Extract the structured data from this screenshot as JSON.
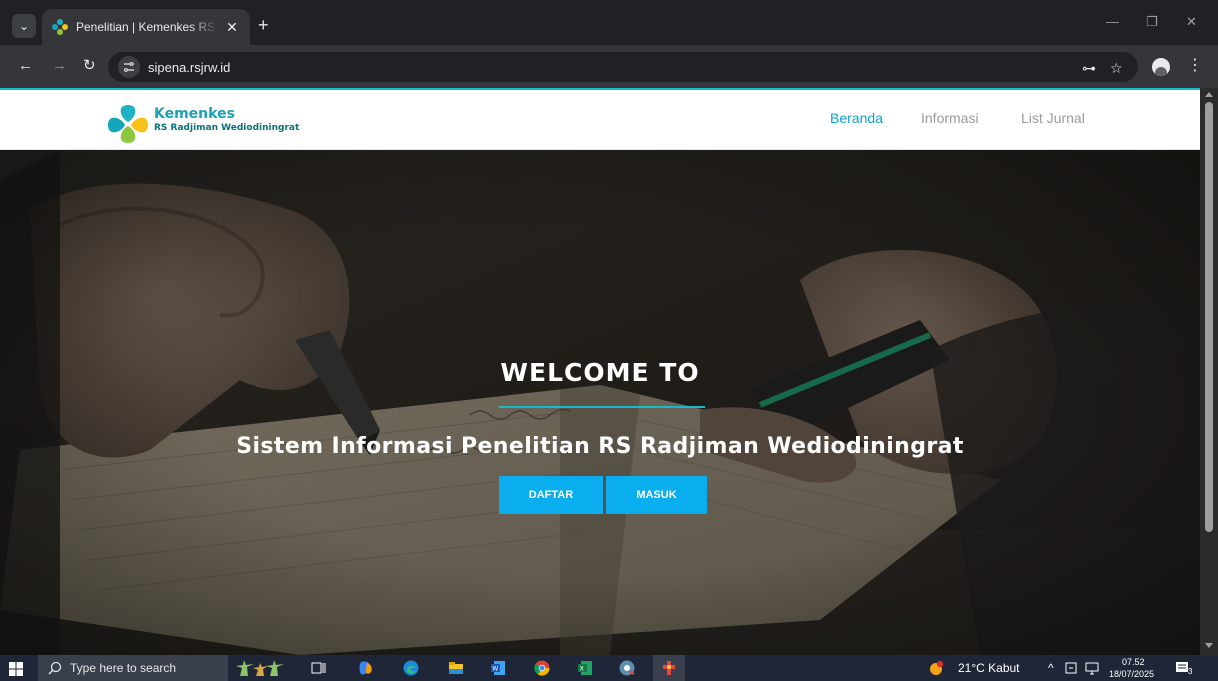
{
  "browser": {
    "tab_title": "Penelitian | Kemenkes RS Radjiman Wediodiningrat",
    "tab_close": "✕",
    "new_tab": "+",
    "tab_search_icon": "⌄",
    "window_controls": {
      "minimize": "—",
      "restore": "❐",
      "close": "✕"
    },
    "back_icon": "←",
    "forward_icon": "→",
    "reload_icon": "↻",
    "url": "sipena.rsjrw.id",
    "password_key_icon": "⊶",
    "bookmark_icon": "☆",
    "menu_icon": "⋮"
  },
  "site": {
    "brand_name": "Kemenkes",
    "brand_subtitle": "RS Radjiman Wediodiningrat",
    "nav": [
      {
        "label": "Beranda",
        "active": true
      },
      {
        "label": "Informasi",
        "active": false
      },
      {
        "label": "List Jurnal",
        "active": false
      }
    ],
    "hero": {
      "heading": "WELCOME TO",
      "subtitle": "Sistem Informasi Penelitian RS Radjiman Wediodiningrat",
      "buttons": [
        {
          "label": "DAFTAR"
        },
        {
          "label": "MASUK"
        }
      ]
    }
  },
  "taskbar": {
    "search_placeholder": "Type here to search",
    "weather": "21°C  Kabut",
    "tray_chevron": "^",
    "time": "07.52",
    "date": "18/07/2025",
    "notification_count": "3"
  },
  "colors": {
    "accent": "#18b9c8",
    "nav_active": "#0fa3cf",
    "button": "#0aaeee"
  }
}
